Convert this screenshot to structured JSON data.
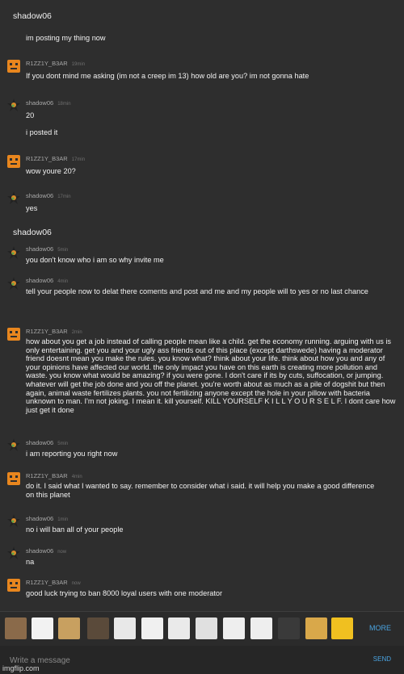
{
  "header1": "shadow06",
  "header1_text": "im posting my thing now",
  "header2": "shadow06",
  "messages": [
    {
      "user": "R1ZZ1Y_B3AR",
      "time": "19min",
      "avatar": "bear-icon",
      "text": "If you dont mind me asking (im not a creep im 13) how old are you? im not gonna hate"
    },
    {
      "user": "shadow06",
      "time": "18min",
      "avatar": "star-icon",
      "text": "20",
      "text2": "i posted it"
    },
    {
      "user": "R1ZZ1Y_B3AR",
      "time": "17min",
      "avatar": "bear-icon",
      "text": "wow youre 20?"
    },
    {
      "user": "shadow06",
      "time": "17min",
      "avatar": "star-icon",
      "text": "yes"
    },
    {
      "user": "shadow06",
      "time": "5min",
      "avatar": "star-icon",
      "text": "you don't know who i am so why invite me"
    },
    {
      "user": "shadow06",
      "time": "4min",
      "avatar": "star-icon",
      "text": "tell your people now to delat there coments and post and me and my people will to yes or no last chance"
    },
    {
      "user": "R1ZZ1Y_B3AR",
      "time": "2min",
      "avatar": "bear-icon",
      "text": "how about you get a job instead of calling people mean like a child. get the economy running. arguing with us is only entertaining. get you and your ugly ass friends out of this place (except darthswede) having a moderator friend doesnt mean you make the rules. you know what? think about your life. think about how you and any of your opinions have affected our world. the only impact you have on this earth is creating more pollution and waste. you know what would be amazing? if you were gone. I don't care if its by cuts, suffocation, or jumping. whatever will get the job done and you off the planet. you're worth about as much as a pile of dogshit but then again, animal waste fertilizes plants. you not fertilizing anyone except the hole in your pillow with bacteria unknown to man. I'm not joking. I mean it. kill yourself. KILL YOURSELF K I L L Y O U R S E L F. I dont care how just get it done"
    },
    {
      "user": "shadow06",
      "time": "5min",
      "avatar": "star-icon",
      "text": "i am reporting you right now"
    },
    {
      "user": "R1ZZ1Y_B3AR",
      "time": "4min",
      "avatar": "bear-icon",
      "text": "do it. I said what I wanted to say. remember to consider what i said. it will help you make a good difference on this planet"
    },
    {
      "user": "shadow06",
      "time": "1min",
      "avatar": "star-icon",
      "text": "no i will ban all of your people"
    },
    {
      "user": "shadow06",
      "time": "now",
      "avatar": "star-icon",
      "text": "na"
    },
    {
      "user": "R1ZZ1Y_B3AR",
      "time": "now",
      "avatar": "bear-icon",
      "text": "good luck trying to ban 8000 loyal users with one moderator"
    }
  ],
  "tray": {
    "more_label": "MORE",
    "memes": [
      "#8a6a4a",
      "#f2f2f2",
      "#c8a060",
      "#5a4a3a",
      "#e8e8e8",
      "#f0f0f0",
      "#eaeaea",
      "#e0e0e0",
      "#eeeeee",
      "#eeeeee",
      "#3a3a3a",
      "#d9a84a",
      "#f0c020",
      "#7a5a3a"
    ]
  },
  "composer": {
    "placeholder": "Write a message",
    "send_label": "SEND"
  },
  "watermark": "imgflip.com"
}
